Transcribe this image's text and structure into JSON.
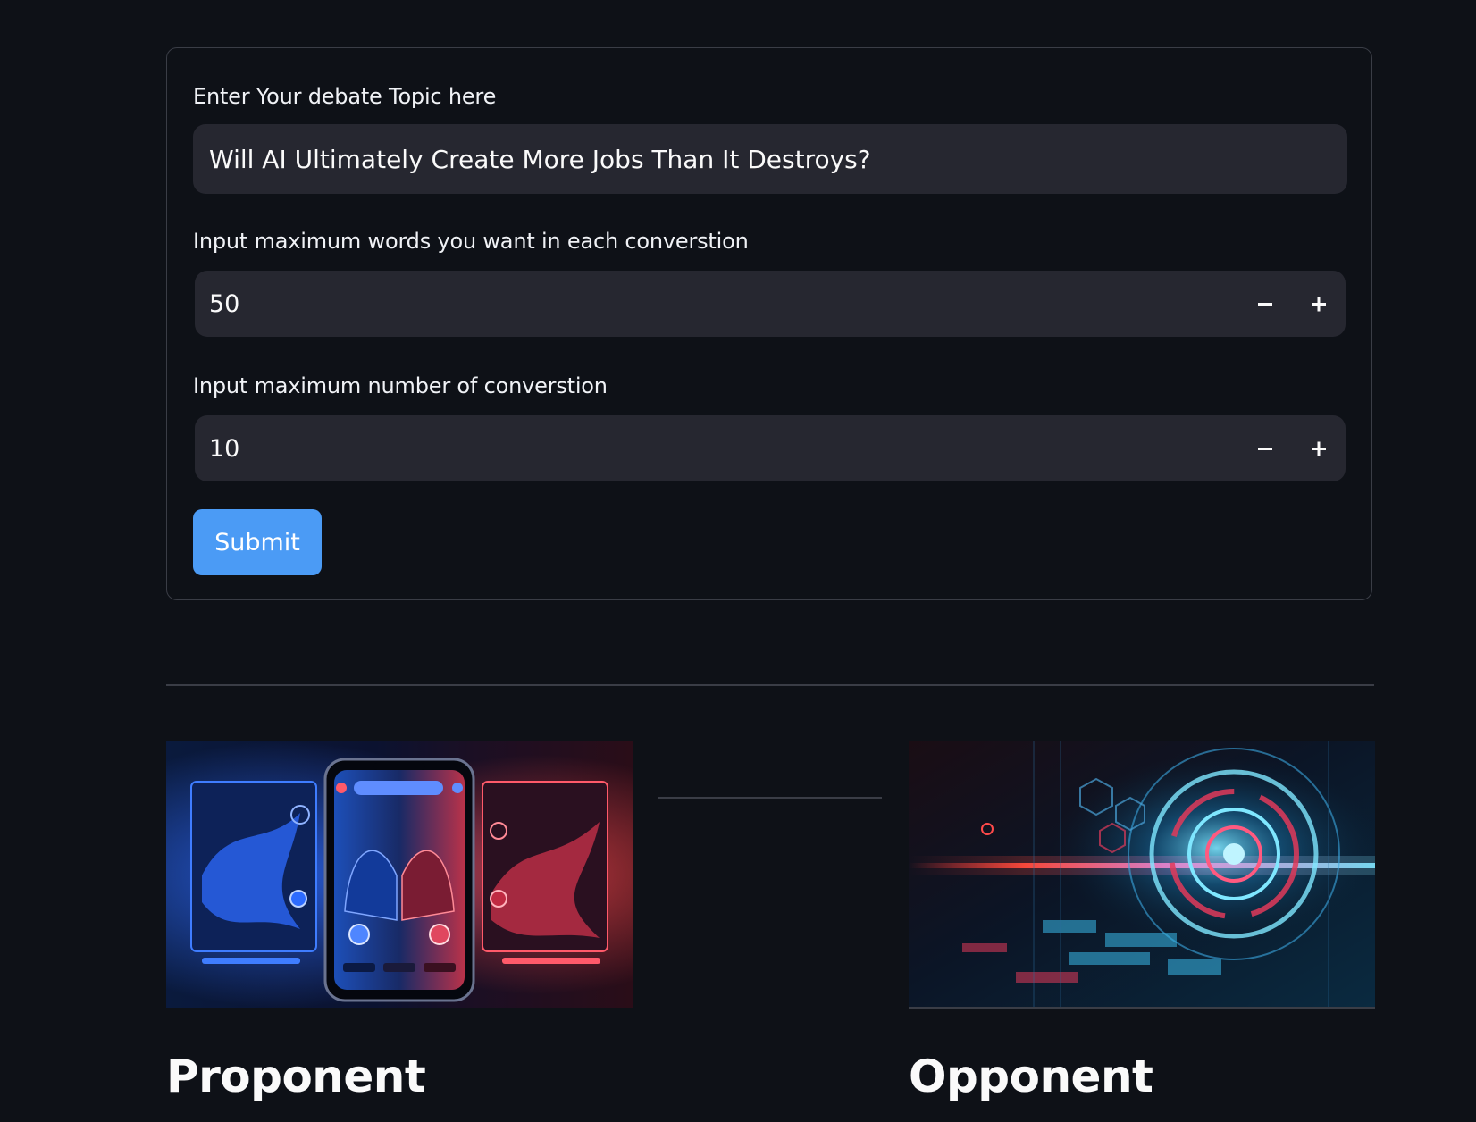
{
  "form": {
    "topic_label": "Enter Your debate Topic here",
    "topic_value": "Will AI Ultimately Create More Jobs Than It Destroys?",
    "max_words_label": "Input maximum words you want in each converstion",
    "max_words_value": "50",
    "max_conversations_label": "Input maximum number of converstion",
    "max_conversations_value": "10",
    "decrement_icon": "minus-icon",
    "increment_icon": "plus-icon",
    "submit_label": "Submit"
  },
  "sides": {
    "proponent": {
      "title": "Proponent",
      "image": "debate-app-phone-illustration"
    },
    "opponent": {
      "title": "Opponent",
      "image": "futuristic-tech-circle-illustration"
    }
  },
  "colors": {
    "background": "#0e1117",
    "input_bg": "#262730",
    "border": "#3a3d46",
    "accent": "#4b9bf5",
    "text": "#fafafa"
  }
}
